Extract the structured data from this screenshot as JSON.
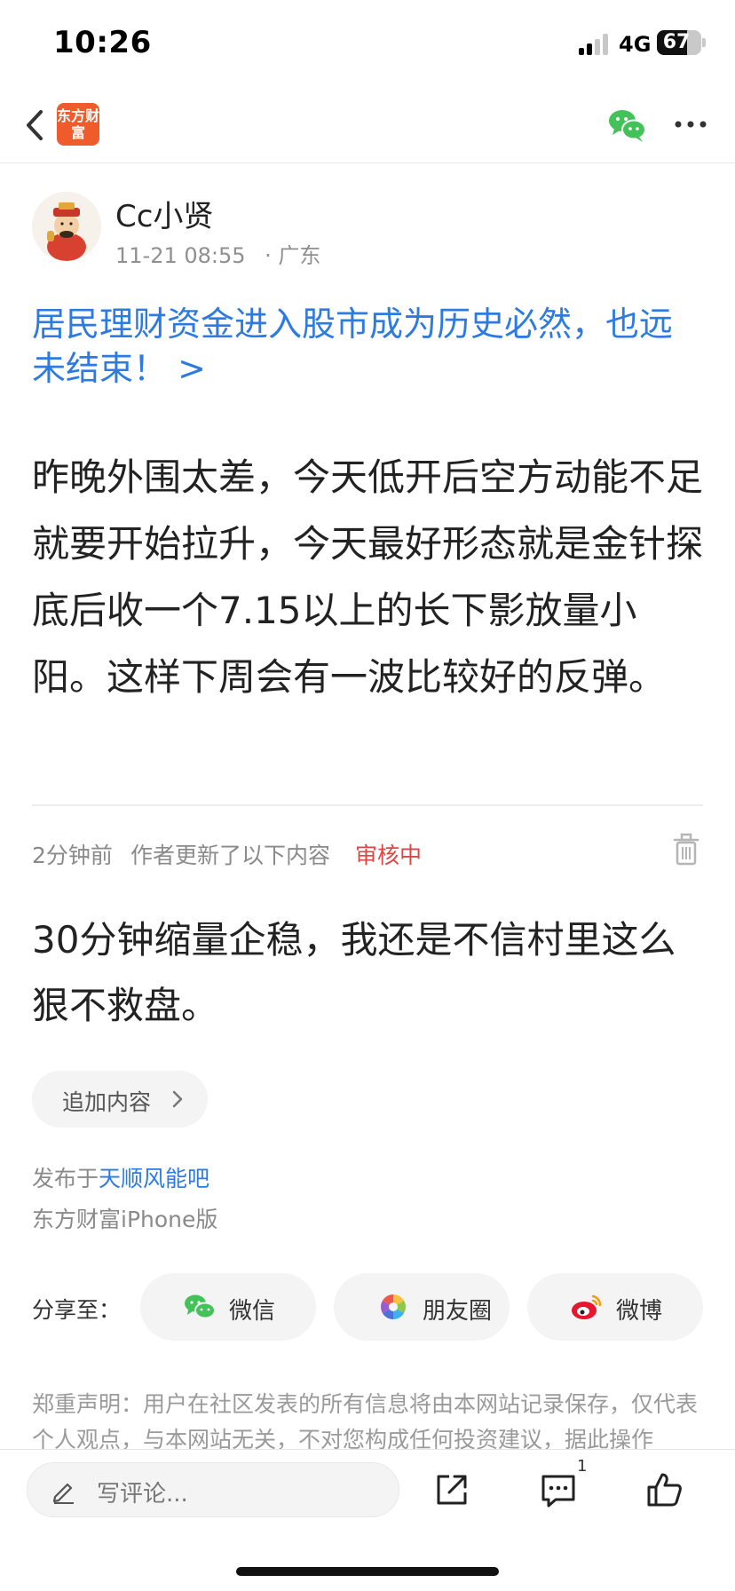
{
  "status_bar": {
    "time": "10:26",
    "network": "4G",
    "battery": "67"
  },
  "nav": {
    "app_logo": "东方财富"
  },
  "author": {
    "name": "Cc小贤",
    "time": "11-21 08:55",
    "location": "· 广东"
  },
  "post": {
    "link_title": "居民理财资金进入股市成为历史必然，也远未结束！ >",
    "body": "昨晚外围太差，今天低开后空方动能不足就要开始拉升，今天最好形态就是金针探底后收一个7.15以上的长下影放量小阳。这样下周会有一波比较好的反弹。"
  },
  "update": {
    "time": "2分钟前",
    "note": "作者更新了以下内容",
    "status": "审核中",
    "body": "30分钟缩量企稳，我还是不信村里这么狠不救盘。"
  },
  "append_button": "追加内容",
  "publish": {
    "prefix": "发布于",
    "forum": "天顺风能吧",
    "platform": "东方财富iPhone版"
  },
  "share": {
    "label": "分享至：",
    "options": [
      {
        "label": "微信",
        "icon": "wechat-icon"
      },
      {
        "label": "朋友圈",
        "icon": "moments-icon"
      },
      {
        "label": "微博",
        "icon": "weibo-icon"
      }
    ]
  },
  "disclaimer": "郑重声明：用户在社区发表的所有信息将由本网站记录保存，仅代表个人观点，与本网站无关，不对您构成任何投资建议，据此操作",
  "bottom_bar": {
    "comment_placeholder": "写评论...",
    "comment_count": "1"
  },
  "colors": {
    "accent_blue": "#2d7ae0",
    "status_red": "#e04545",
    "wechat_green": "#44c25a",
    "logo_orange": "#ef5b2b"
  },
  "icons": [
    "back-arrow-icon",
    "wechat-icon",
    "more-icon",
    "trash-icon",
    "chevron-right-icon",
    "moments-icon",
    "weibo-icon",
    "pen-icon",
    "share-out-icon",
    "comment-icon",
    "like-icon"
  ]
}
